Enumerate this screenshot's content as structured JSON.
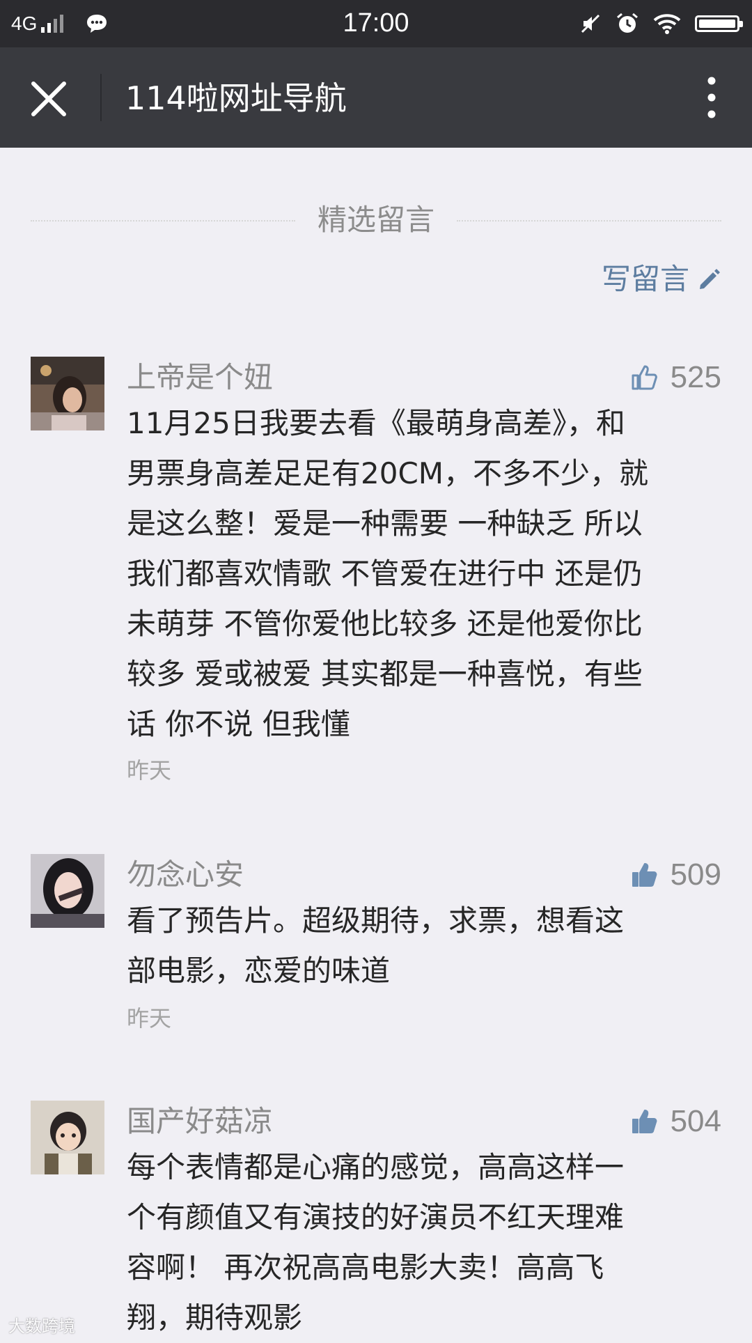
{
  "status_bar": {
    "network": "4G",
    "time": "17:00",
    "icons": [
      "signal-icon",
      "chat-icon",
      "mute-icon",
      "alarm-icon",
      "wifi-icon",
      "battery-charging-icon"
    ]
  },
  "header": {
    "title": "114啦网址导航",
    "close_icon": "close-icon",
    "more_icon": "more-vertical-icon"
  },
  "section": {
    "title": "精选留言",
    "write_label": "写留言",
    "write_icon": "pencil-icon"
  },
  "comments": [
    {
      "nickname": "上帝是个妞",
      "likes": "525",
      "liked": false,
      "lines": [
        "11月25日我要去看《最萌身高差》，和",
        "男票身高差足足有20CM，不多不少，就",
        "是这么整！爱是一种需要 一种缺乏 所以",
        "我们都喜欢情歌 不管爱在进行中 还是仍",
        "未萌芽 不管你爱他比较多 还是他爱你比",
        "较多 爱或被爱 其实都是一种喜悦，有些",
        "话 你不说 但我懂"
      ],
      "time": "昨天"
    },
    {
      "nickname": "勿念心安",
      "likes": "509",
      "liked": true,
      "lines": [
        "看了预告片。超级期待，求票，想看这",
        "部电影，恋爱的味道"
      ],
      "time": "昨天"
    },
    {
      "nickname": "国产好菇凉",
      "likes": "504",
      "liked": true,
      "lines": [
        "每个表情都是心痛的感觉，高高这样一",
        "个有颜值又有演技的好演员不红天理难",
        "容啊！ 再次祝高高电影大卖！高高飞",
        "翔，期待观影"
      ]
    }
  ],
  "watermark": "大数跨境",
  "colors": {
    "status_bar": "#2b2b2f",
    "title_bar": "#393a3f",
    "background": "#f0eff4",
    "link": "#5d7da0",
    "like_icon": "#6d8fb4"
  }
}
